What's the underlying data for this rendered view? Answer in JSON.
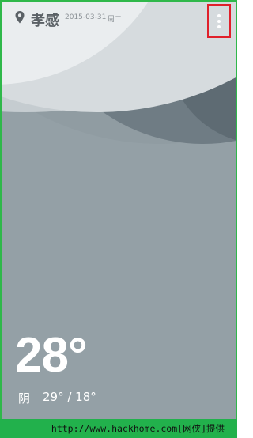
{
  "header": {
    "city": "孝感",
    "date": "2015-03-31",
    "weekday": "周二",
    "menu_icon": "more-vertical-icon",
    "location_icon": "location-pin-icon"
  },
  "weather": {
    "current_temp": "28°",
    "condition": "阴",
    "temp_range": "29° / 18°"
  },
  "footer": {
    "watermark": "http://www.hackhome.com[网侠]提供"
  },
  "colors": {
    "background": "#94a0a6",
    "highlight_box": "#e0202a",
    "footer_bar": "#22b14c"
  }
}
